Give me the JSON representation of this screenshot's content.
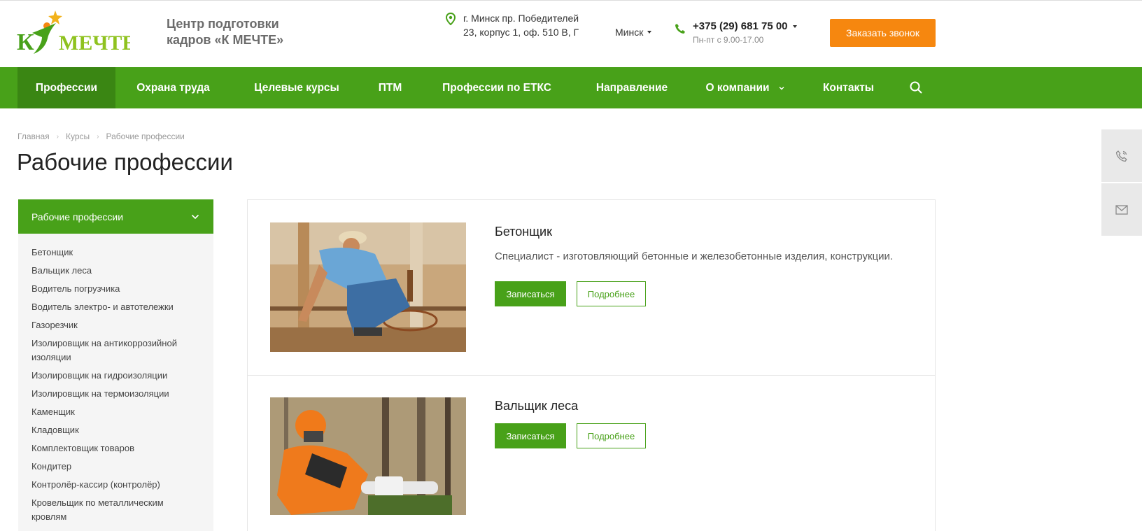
{
  "header": {
    "logo_text": "К МЕЧТЕ",
    "org_name": "Центр подготовки кадров «К МЕЧТЕ»",
    "address": "г. Минск пр. Победителей 23, корпус 1, оф. 510 В, Г",
    "city": "Минск",
    "phone": "+375 (29) 681 75 00",
    "hours": "Пн-пт с 9.00-17.00",
    "callback_label": "Заказать звонок"
  },
  "nav": {
    "items": [
      {
        "label": "Профессии"
      },
      {
        "label": "Охрана труда"
      },
      {
        "label": "Целевые курсы"
      },
      {
        "label": "ПТМ"
      },
      {
        "label": "Профессии по ЕТКС"
      },
      {
        "label": "Направление"
      },
      {
        "label": "О компании"
      },
      {
        "label": "Контакты"
      }
    ]
  },
  "breadcrumb": [
    "Главная",
    "Курсы",
    "Рабочие профессии"
  ],
  "page_title": "Рабочие профессии",
  "sidebar": {
    "header": "Рабочие профессии",
    "items": [
      "Бетонщик",
      "Вальщик леса",
      "Водитель погрузчика",
      "Водитель электро- и автотележки",
      "Газорезчик",
      "Изолировщик на антикоррозийной изоляции",
      "Изолировщик на гидроизоляции",
      "Изолировщик на термоизоляции",
      "Каменщик",
      "Кладовщик",
      "Комплектовщик товаров",
      "Кондитер",
      "Контролёр-кассир (контролёр)",
      "Кровельщик по металлическим кровлям"
    ]
  },
  "cards": [
    {
      "title": "Бетонщик",
      "description": "Специалист - изготовляющий бетонные и железобетонные изделия, конструкции.",
      "enroll_label": "Записаться",
      "more_label": "Подробнее"
    },
    {
      "title": "Вальщик леса",
      "enroll_label": "Записаться",
      "more_label": "Подробнее"
    }
  ],
  "colors": {
    "brand_green": "#48a119",
    "nav_active": "#3a8613",
    "accent_orange": "#f6870f"
  },
  "icons": {
    "location": "map-pin-icon",
    "phone": "phone-icon",
    "search": "search-icon",
    "float_phone": "phone-ring-icon",
    "float_mail": "mail-icon"
  }
}
